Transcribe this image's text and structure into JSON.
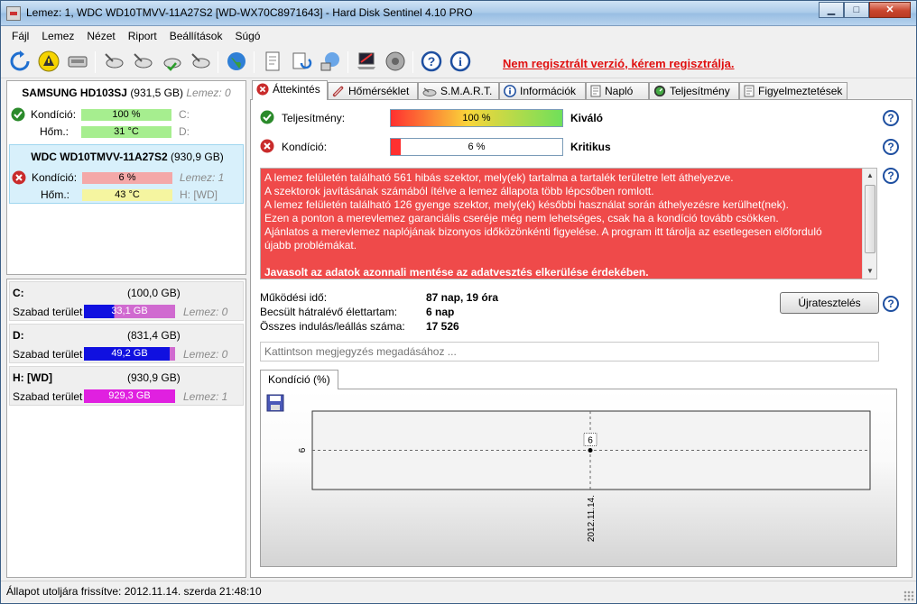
{
  "window": {
    "title": "Lemez: 1, WDC WD10TMVV-11A27S2 [WD-WX70C8971643]  -  Hard Disk Sentinel 4.10 PRO",
    "minimize": "▁",
    "maximize": "□",
    "close": "✕"
  },
  "menu": [
    "Fájl",
    "Lemez",
    "Nézet",
    "Riport",
    "Beállítások",
    "Súgó"
  ],
  "toolbar": {
    "register_link": "Nem regisztrált verzió, kérem regisztrálja."
  },
  "disks": [
    {
      "name": "SAMSUNG HD103SJ",
      "size": "(931,5 GB)",
      "note": "Lemez: 0",
      "status_icon": "ok-icon",
      "condition_label": "Kondíció:",
      "condition_value": "100 %",
      "condition_percent": 100,
      "condition_color": "#a6ee8f",
      "drive1": "C:",
      "temp_label": "Hőm.:",
      "temp_value": "31 °C",
      "temp_color": "#a6ee8f",
      "drive2": "D:"
    },
    {
      "name": "WDC WD10TMVV-11A27S2",
      "size": "(930,9 GB)",
      "note": "Lemez: 1",
      "status_icon": "error-icon",
      "condition_label": "Kondíció:",
      "condition_value": "6 %",
      "condition_percent": 6,
      "condition_color": "#f4a8a8",
      "drive1": "Lemez: 1",
      "temp_label": "Hőm.:",
      "temp_value": "43 °C",
      "temp_color": "#f5f5a0",
      "drive2": "H: [WD]"
    }
  ],
  "volumes": [
    {
      "name": "C:",
      "size": "(100,0 GB)",
      "free_label": "Szabad terület",
      "free_value": "33,1 GB",
      "note": "Lemez: 0",
      "used_fraction": 0.669,
      "bar_color": "#1010e0",
      "used_color": "#d06ad0"
    },
    {
      "name": "D:",
      "size": "(831,4 GB)",
      "free_label": "Szabad terület",
      "free_value": "49,2 GB",
      "note": "Lemez: 0",
      "used_fraction": 0.059,
      "bar_color": "#1010e0",
      "used_color": "#d06ad0"
    },
    {
      "name": "H: [WD]",
      "size": "(930,9 GB)",
      "free_label": "Szabad terület",
      "free_value": "929,3 GB",
      "note": "Lemez: 1",
      "used_fraction": 0.002,
      "bar_color": "#e020e0",
      "used_color": "#e020e0"
    }
  ],
  "tabs": [
    {
      "label": "Áttekintés",
      "icon": "error-icon"
    },
    {
      "label": "Hőmérséklet",
      "icon": "thermometer-icon"
    },
    {
      "label": "S.M.A.R.T.",
      "icon": "smart-icon"
    },
    {
      "label": "Információk",
      "icon": "info-icon"
    },
    {
      "label": "Napló",
      "icon": "log-icon"
    },
    {
      "label": "Teljesítmény",
      "icon": "gauge-icon"
    },
    {
      "label": "Figyelmeztetések",
      "icon": "alert-icon"
    }
  ],
  "overview": {
    "performance": {
      "label": "Teljesítmény:",
      "value": "100 %",
      "percent": 100,
      "verdict": "Kiváló"
    },
    "condition": {
      "label": "Kondíció:",
      "value": "6 %",
      "percent": 6,
      "verdict": "Kritikus"
    },
    "alert_lines": [
      "A lemez felületén található 561 hibás szektor, mely(ek) tartalma a tartalék területre lett áthelyezve.",
      "A szektorok javításának számából ítélve a lemez állapota több lépcsőben romlott.",
      "A lemez felületén található 126 gyenge szektor, mely(ek) későbbi használat során áthelyezésre kerülhet(nek).",
      "Ezen a ponton a merevlemez garanciális cseréje még nem lehetséges, csak ha a kondíció tovább csökken.",
      "Ajánlatos a merevlemez naplójának bizonyos időközönkénti figyelése. A program itt tárolja az esetlegesen előforduló",
      "újabb problémákat."
    ],
    "alert_strong": "Javasolt az adatok azonnali mentése az adatvesztés elkerülése érdekében.",
    "stats": [
      {
        "label": "Működési idő:",
        "value": "87 nap, 19 óra"
      },
      {
        "label": "Becsült hátralévő élettartam:",
        "value": "6 nap"
      },
      {
        "label": "Összes indulás/leállás száma:",
        "value": "17 526"
      }
    ],
    "retest_button": "Újratesztelés",
    "note_placeholder": "Kattintson megjegyzés megadásához ..."
  },
  "chart_tab_label": "Kondíció  (%)",
  "chart_data": {
    "type": "line",
    "title": "",
    "x": [
      "2012.11.14."
    ],
    "series": [
      {
        "values": [
          6
        ]
      }
    ],
    "ytick_labels": [
      "6"
    ],
    "data_labels": [
      "6"
    ],
    "grid": true,
    "legend": "none"
  },
  "status": "Állapot utoljára frissítve: 2012.11.14. szerda 21:48:10"
}
